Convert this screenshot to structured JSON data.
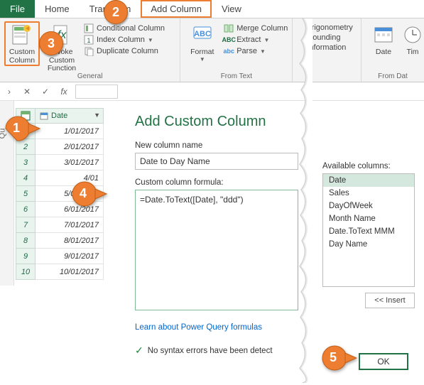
{
  "menu": {
    "file": "File",
    "home": "Home",
    "transform": "Transform",
    "add_column": "Add Column",
    "view": "View"
  },
  "ribbon": {
    "general": {
      "label": "General",
      "custom_column": "Custom\nColumn",
      "invoke_fn": "Invoke Custom\nFunction",
      "conditional": "Conditional Column",
      "index": "Index Column",
      "duplicate": "Duplicate Column"
    },
    "from_text": {
      "label": "From Text",
      "format": "Format",
      "merge": "Merge Column",
      "extract": "Extract",
      "parse": "Parse"
    },
    "from_number": {
      "trig": "Trigonometry",
      "rounding": "Rounding",
      "info": "Information"
    },
    "from_date": {
      "label": "From Dat",
      "date": "Date",
      "time": "Tim"
    }
  },
  "grid": {
    "col_header": "Date",
    "rows": [
      {
        "n": "1",
        "v": "1/01/2017"
      },
      {
        "n": "2",
        "v": "2/01/2017"
      },
      {
        "n": "3",
        "v": "3/01/2017"
      },
      {
        "n": "4",
        "v": "4/01"
      },
      {
        "n": "5",
        "v": "5/01/2017"
      },
      {
        "n": "6",
        "v": "6/01/2017"
      },
      {
        "n": "7",
        "v": "7/01/2017"
      },
      {
        "n": "8",
        "v": "8/01/2017"
      },
      {
        "n": "9",
        "v": "9/01/2017"
      },
      {
        "n": "10",
        "v": "10/01/2017"
      }
    ]
  },
  "side_rail": "Qu",
  "dialog": {
    "title": "Add Custom Column",
    "name_label": "New column name",
    "name_value": "Date to Day Name",
    "formula_label": "Custom column formula:",
    "formula_value": "=Date.ToText([Date], \"ddd\")",
    "avail_label": "Available columns:",
    "avail": [
      "Date",
      "Sales",
      "DayOfWeek",
      "Month Name",
      "Date.ToText MMM",
      "Day Name"
    ],
    "insert": "<< Insert",
    "learn": "Learn about Power Query formulas",
    "status": "No syntax errors have been detect",
    "ok": "OK"
  },
  "callouts": {
    "1": "1",
    "2": "2",
    "3": "3",
    "4": "4",
    "5": "5"
  }
}
